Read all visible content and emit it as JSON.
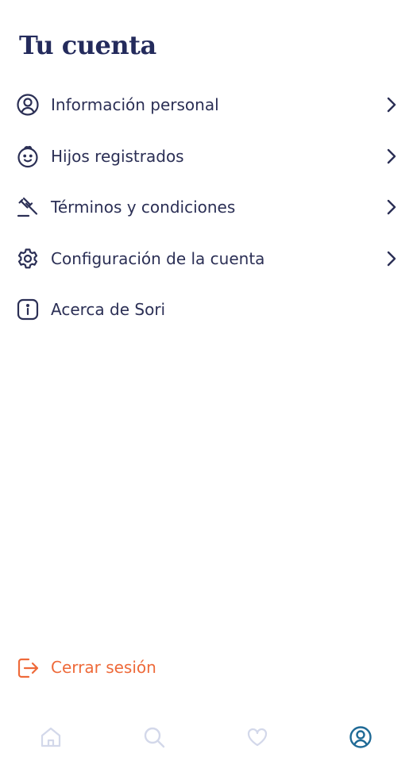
{
  "page": {
    "title": "Tu cuenta"
  },
  "menu": {
    "items": [
      {
        "label": "Información personal",
        "icon": "user-circle-icon",
        "has_chevron": true
      },
      {
        "label": "Hijos registrados",
        "icon": "baby-face-icon",
        "has_chevron": true
      },
      {
        "label": "Términos y condiciones",
        "icon": "gavel-icon",
        "has_chevron": true
      },
      {
        "label": "Configuración de la cuenta",
        "icon": "gear-icon",
        "has_chevron": true
      },
      {
        "label": "Acerca de Sori",
        "icon": "info-icon",
        "has_chevron": false
      }
    ]
  },
  "logout": {
    "label": "Cerrar sesión",
    "icon": "logout-icon"
  },
  "tabbar": {
    "tabs": [
      {
        "name": "home",
        "icon": "home-icon",
        "active": false
      },
      {
        "name": "search",
        "icon": "search-icon",
        "active": false
      },
      {
        "name": "favorites",
        "icon": "heart-icon",
        "active": false
      },
      {
        "name": "account",
        "icon": "user-circle-icon",
        "active": true
      }
    ]
  },
  "colors": {
    "text": "#2b2f55",
    "title": "#242b5c",
    "logout": "#ee6a3a",
    "tab_inactive": "#d3d8ea",
    "tab_active": "#1f6a96"
  }
}
